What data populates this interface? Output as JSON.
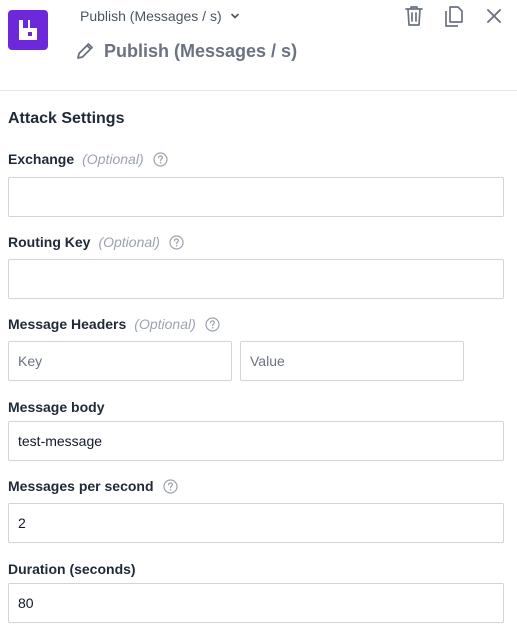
{
  "header": {
    "breadcrumb": "Publish (Messages / s)",
    "title": "Publish (Messages / s)",
    "icons": {
      "logo": "rabbitmq-logo-icon",
      "dropdown": "chevron-down-icon",
      "edit": "pencil-icon",
      "delete": "trash-icon",
      "duplicate": "copy-icon",
      "close": "close-icon"
    }
  },
  "section": {
    "title": "Attack Settings"
  },
  "fields": {
    "exchange": {
      "label": "Exchange",
      "optional": "(Optional)",
      "value": "",
      "placeholder": ""
    },
    "routing_key": {
      "label": "Routing Key",
      "optional": "(Optional)",
      "value": "",
      "placeholder": ""
    },
    "message_headers": {
      "label": "Message Headers",
      "optional": "(Optional)",
      "key_placeholder": "Key",
      "value_placeholder": "Value"
    },
    "message_body": {
      "label": "Message body",
      "value": "test-message"
    },
    "messages_per_second": {
      "label": "Messages per second",
      "value": "2"
    },
    "duration": {
      "label": "Duration (seconds)",
      "value": "80"
    }
  },
  "colors": {
    "brand": "#6d28d9",
    "border": "#d1d5db",
    "muted": "#9ca3af"
  }
}
